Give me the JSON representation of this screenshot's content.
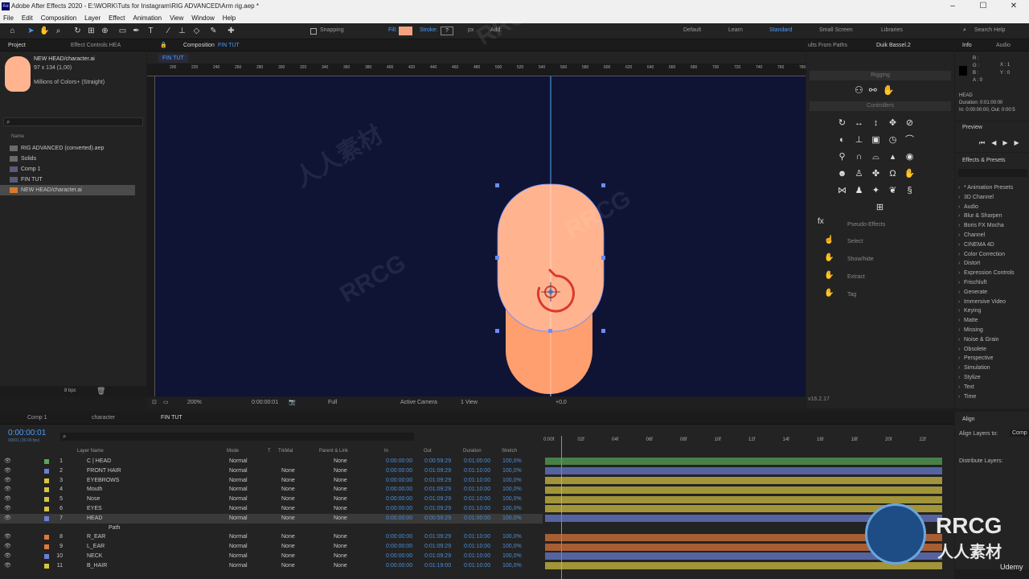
{
  "title": "Adobe After Effects 2020 - E:\\WORK\\Tuts for Instagram\\RIG ADVANCED\\Arm rig.aep *",
  "logo": "Ae",
  "menu": [
    "File",
    "Edit",
    "Composition",
    "Layer",
    "Effect",
    "Animation",
    "View",
    "Window",
    "Help"
  ],
  "toolbar": {
    "snapping": "Snapping",
    "fill": "Fill:",
    "stroke": "Stroke:",
    "stroke_val": "?",
    "px": "px",
    "add": "Add:",
    "workspaces": [
      "Default",
      "Learn",
      "Standard",
      "Small Screen",
      "Libraries"
    ],
    "search": "Search Help"
  },
  "project": {
    "tab": "Project",
    "tab2": "Effect Controls HEA",
    "item_name": "NEW HEAD/character.ai",
    "dims": "97 x 134 (1,00)",
    "colors": "Millions of Colors+ (Straight)",
    "name_col": "Name",
    "items": [
      "RIG ADVANCED (converted).aep",
      "Solids",
      "Comp 1",
      "FIN TUT",
      "NEW HEAD/character.ai"
    ]
  },
  "comp": {
    "tab_label": "Composition",
    "comp_name": "FIN TUT",
    "sub_tab": "FIN TUT",
    "ruler": [
      "200",
      "220",
      "240",
      "260",
      "280",
      "300",
      "320",
      "340",
      "360",
      "380",
      "400",
      "420",
      "440",
      "460",
      "480",
      "500",
      "520",
      "540",
      "560",
      "580",
      "600",
      "620",
      "640",
      "660",
      "680",
      "700",
      "720",
      "740",
      "760",
      "780"
    ],
    "zoom": "200%",
    "timecode": "0:00:00:01",
    "resolution": "Full",
    "camera": "Active Camera",
    "view": "1 View",
    "offset": "+0,0",
    "bpc": "8 bpc"
  },
  "duik": {
    "tab1": "ults From Paths",
    "tab2": "Duik Bassel.2",
    "rigging": "Rigging",
    "controllers": "Controllers",
    "pseudo": "Pseudo-Effects",
    "select": "Select",
    "showhide": "Show/hide",
    "extract": "Extract",
    "tag": "Tag",
    "version": "v16.2.17",
    "fx": "fx"
  },
  "info": {
    "tab": "Info",
    "tab2": "Audio",
    "r": "R :",
    "g": "G :",
    "b": "B :",
    "a": "A : 0",
    "x": "X : 1",
    "y": "Y : 0",
    "layer": "HEAD",
    "duration": "Duration: 0:01:00:00",
    "inout": "In: 0:00:00:00, Out: 0:00:5"
  },
  "preview": {
    "title": "Preview"
  },
  "effects": {
    "title": "Effects & Presets",
    "items": [
      "* Animation Presets",
      "3D Channel",
      "Audio",
      "Blur & Sharpen",
      "Boris FX Mocha",
      "Channel",
      "CINEMA 4D",
      "Color Correction",
      "Distort",
      "Expression Controls",
      "Frischluft",
      "Generate",
      "Immersive Video",
      "Keying",
      "Matte",
      "Missing",
      "Noise & Grain",
      "Obsolete",
      "Perspective",
      "Simulation",
      "Stylize",
      "Text",
      "Time"
    ]
  },
  "align": {
    "title": "Align",
    "align_to": "Align Layers to:",
    "comp": "Comp",
    "distribute": "Distribute Layers:"
  },
  "timeline": {
    "tabs": [
      "Comp 1",
      "character",
      "FIN TUT"
    ],
    "timecode": "0:00:00:01",
    "fps": "00001 (30.00 fps)",
    "cols": {
      "layer": "Layer Name",
      "mode": "Mode",
      "t": "T",
      "trkmat": "TrkMat",
      "parent": "Parent & Link",
      "in": "In",
      "out": "Out",
      "dur": "Duration",
      "stretch": "Stretch"
    },
    "ruler": [
      "0:00f",
      "02f",
      "04f",
      "06f",
      "08f",
      "10f",
      "12f",
      "14f",
      "16f",
      "18f",
      "20f",
      "22f"
    ],
    "layers": [
      {
        "num": "1",
        "name": "C | HEAD",
        "mode": "Normal",
        "trk": "",
        "parent": "None",
        "in": "0:00:00:00",
        "out": "0:00:59:29",
        "dur": "0:01:00:00",
        "str": "100,0%",
        "color": "#58a85a"
      },
      {
        "num": "2",
        "name": "FRONT HAIR",
        "mode": "Normal",
        "trk": "None",
        "parent": "None",
        "in": "0:00:00:00",
        "out": "0:01:09:29",
        "dur": "0:01:10:00",
        "str": "100,0%",
        "color": "#6b7fd6"
      },
      {
        "num": "3",
        "name": "EYEBROWS",
        "mode": "Normal",
        "trk": "None",
        "parent": "None",
        "in": "0:00:00:00",
        "out": "0:01:09:29",
        "dur": "0:01:10:00",
        "str": "100,0%",
        "color": "#d8c441"
      },
      {
        "num": "4",
        "name": "Mouth",
        "mode": "Normal",
        "trk": "None",
        "parent": "None",
        "in": "0:00:00:00",
        "out": "0:01:09:29",
        "dur": "0:01:10:00",
        "str": "100,0%",
        "color": "#d8c441"
      },
      {
        "num": "5",
        "name": "Nose",
        "mode": "Normal",
        "trk": "None",
        "parent": "None",
        "in": "0:00:00:00",
        "out": "0:01:09:29",
        "dur": "0:01:10:00",
        "str": "100,0%",
        "color": "#d8c441"
      },
      {
        "num": "6",
        "name": "EYES",
        "mode": "Normal",
        "trk": "None",
        "parent": "None",
        "in": "0:00:00:00",
        "out": "0:01:09:29",
        "dur": "0:01:10:00",
        "str": "100,0%",
        "color": "#d8c441"
      },
      {
        "num": "7",
        "name": "HEAD",
        "mode": "Normal",
        "trk": "None",
        "parent": "None",
        "in": "0:00:00:00",
        "out": "0:00:59:29",
        "dur": "0:01:00:00",
        "str": "100,0%",
        "color": "#6b7fd6"
      },
      {
        "num": "",
        "name": "Path",
        "mode": "",
        "trk": "",
        "parent": "",
        "in": "",
        "out": "",
        "dur": "",
        "str": "",
        "color": ""
      },
      {
        "num": "8",
        "name": "R_EAR",
        "mode": "Normal",
        "trk": "None",
        "parent": "None",
        "in": "0:00:00:00",
        "out": "0:01:09:29",
        "dur": "0:01:10:00",
        "str": "100,0%",
        "color": "#e0783a"
      },
      {
        "num": "9",
        "name": "L_EAR",
        "mode": "Normal",
        "trk": "None",
        "parent": "None",
        "in": "0:00:00:00",
        "out": "0:01:09:29",
        "dur": "0:01:10:00",
        "str": "100,0%",
        "color": "#e0783a"
      },
      {
        "num": "10",
        "name": "NECK",
        "mode": "Normal",
        "trk": "None",
        "parent": "None",
        "in": "0:00:00:00",
        "out": "0:01:09:29",
        "dur": "0:01:10:00",
        "str": "100,0%",
        "color": "#6b7fd6"
      },
      {
        "num": "11",
        "name": "B_HAIR",
        "mode": "Normal",
        "trk": "None",
        "parent": "None",
        "in": "0:00:00:00",
        "out": "0:01:19:00",
        "dur": "0:01:10:00",
        "str": "100,0%",
        "color": "#d8c441"
      }
    ]
  },
  "watermarks": {
    "rrcg": "RRCG",
    "cn": "人人素材",
    "udemy": "Udemy"
  },
  "colors": {
    "accent": "#2d8ceb",
    "comp_bg": "#0f1435",
    "skin": "#ffb48f",
    "skin_dark": "#ff9e6e",
    "ctrl": "#d93a2b",
    "fill_swatch": "#f2a27f"
  }
}
